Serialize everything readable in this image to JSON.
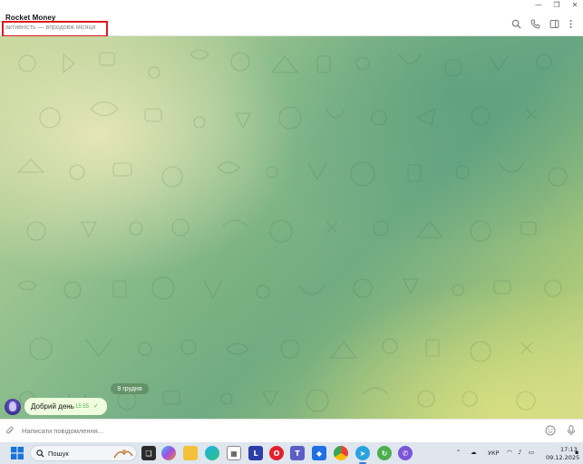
{
  "window": {
    "controls": {
      "minimize": "—",
      "maximize": "❐",
      "close": "✕"
    }
  },
  "header": {
    "title": "Rocket Money",
    "status": "активність — впродовж місяця",
    "icons": [
      "search-icon",
      "phone-icon",
      "sidebar-toggle-icon",
      "more-vertical-icon"
    ]
  },
  "chat": {
    "date_label": "9 грудня",
    "messages": [
      {
        "text": "Добрий день",
        "time": "15:55",
        "status": "✓"
      }
    ]
  },
  "composer": {
    "placeholder": "Написати повідомлення..."
  },
  "taskbar": {
    "search_label": "Пошук",
    "language": "УКР",
    "time": "17:13",
    "date": "09.12.2025",
    "accent": "#3c7be3"
  },
  "colors": {
    "highlight": "#e0161e",
    "bubble": "#effdde",
    "check": "#5aae5a"
  }
}
